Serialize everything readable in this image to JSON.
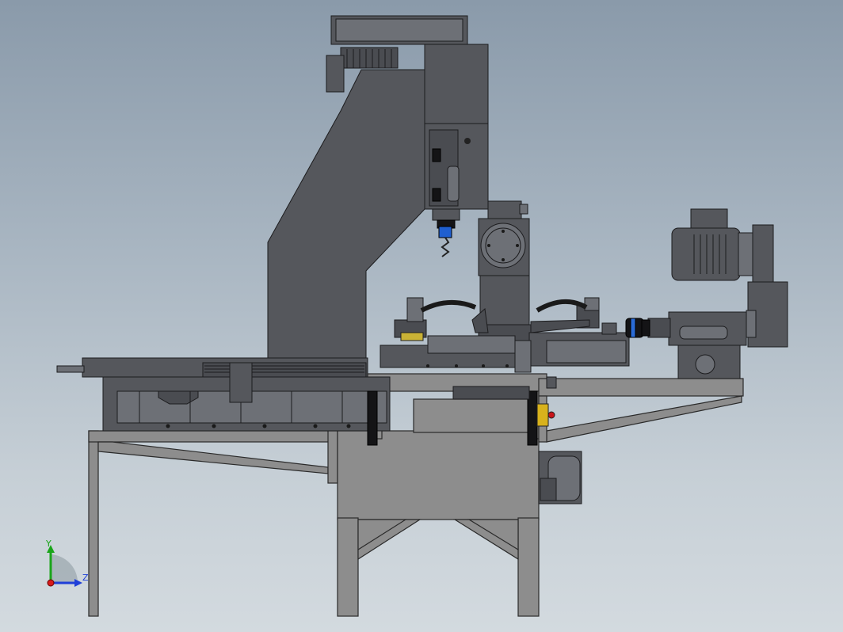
{
  "triad": {
    "y_label": "Y",
    "z_label": "Z",
    "colors": {
      "y": "#1aa51a",
      "z": "#1f3fd8",
      "x": "#d81b1b"
    }
  },
  "colors": {
    "background_top": "#8a9aaa",
    "background_bottom": "#d3dadf",
    "frame": "#8d8d8d",
    "machine_dark": "#55575c",
    "machine_mid": "#6d7076",
    "accent_red": "#c8141a",
    "accent_yellow": "#d8b21c",
    "accent_blue": "#2a6bd6"
  }
}
